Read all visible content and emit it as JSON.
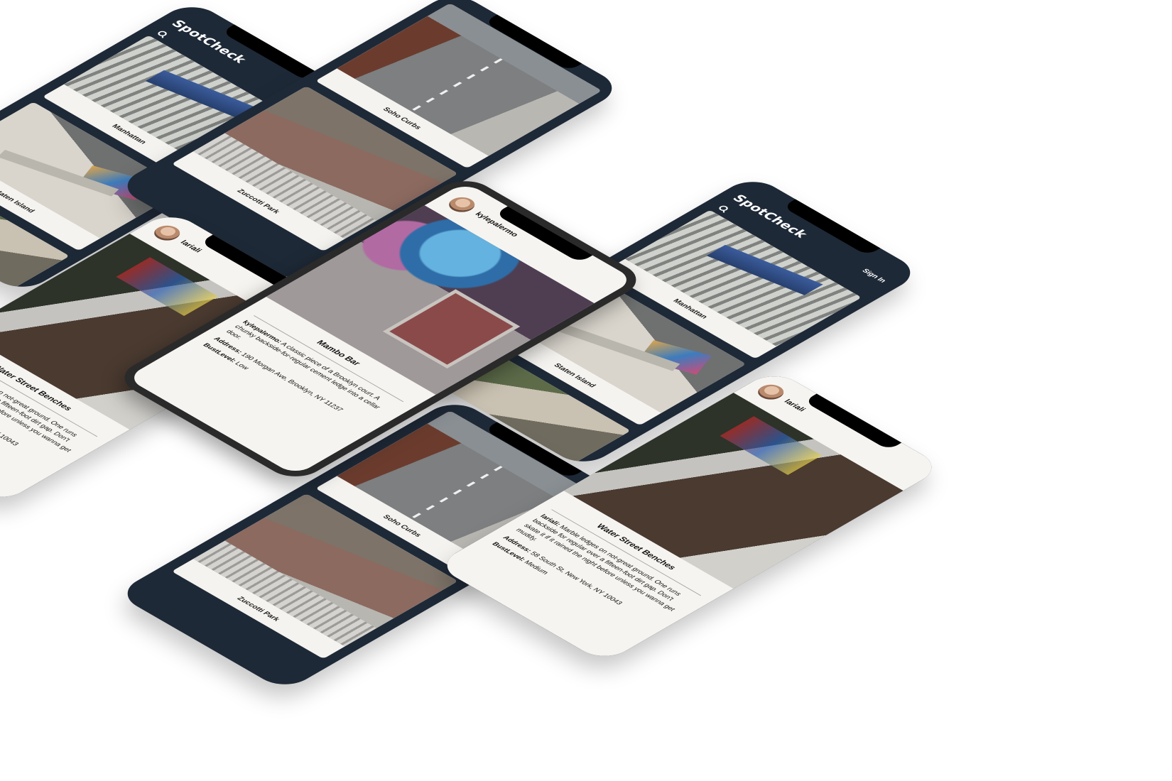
{
  "app": {
    "brand": "SpotCheck",
    "sign_in": "Sign In"
  },
  "list_a": {
    "cards": [
      {
        "caption": "Manhattan"
      },
      {
        "caption": "Staten Island"
      },
      {
        "caption": ""
      }
    ]
  },
  "list_b": {
    "cards": [
      {
        "caption": "Soho Curbs"
      },
      {
        "caption": "Zuccotti Park"
      }
    ]
  },
  "detail_water": {
    "username": "lariali",
    "title": "Water Street Benches",
    "desc_user": "lariali:",
    "desc": "Marble ledges on not-great ground. One runs backside for regular over a fifteen-foot dirt gap. Don't skate it if it rained the night before unless you wanna get muddy.",
    "address_label": "Address:",
    "address": "58 South St, New York, NY 10043",
    "bust_label": "BustLevel:",
    "bust": "Medium"
  },
  "detail_mambo": {
    "username": "kylepalermo",
    "title": "Mambo Bar",
    "desc_user": "kylepalermo:",
    "desc": "A classic piece of a Brooklyn court. A chunky backside-for-regular cement ledge into a cellar door.",
    "address_label": "Address:",
    "address": "190 Morgan Ave, Brooklyn, NY 11237",
    "bust_label": "BustLevel:",
    "bust": "Low"
  }
}
